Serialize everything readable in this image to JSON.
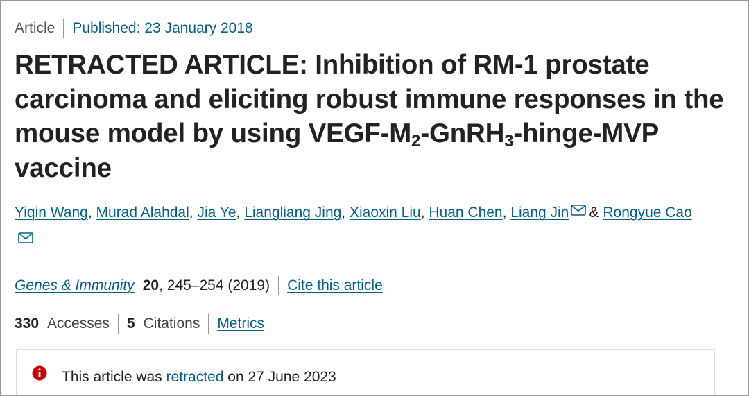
{
  "header": {
    "article_type": "Article",
    "published_label": "Published: 23 January 2018"
  },
  "title": {
    "part1": "RETRACTED ARTICLE: Inhibition of RM-1 prostate carcinoma and eliciting robust immune responses in the mouse model by using VEGF-M",
    "sub1": "2",
    "part2": "-GnRH",
    "sub2": "3",
    "part3": "-hinge-MVP vaccine"
  },
  "authors": [
    {
      "name": "Yiqin Wang",
      "sep": ", "
    },
    {
      "name": "Murad Alahdal",
      "sep": ", "
    },
    {
      "name": "Jia Ye",
      "sep": ", "
    },
    {
      "name": "Liangliang Jing",
      "sep": ", "
    },
    {
      "name": "Xiaoxin Liu",
      "sep": ", "
    },
    {
      "name": "Huan Chen",
      "sep": ", "
    },
    {
      "name": "Liang Jin",
      "sep": ""
    },
    {
      "name": "Rongyue Cao",
      "sep": ""
    }
  ],
  "authors_amp": "&",
  "icons": {
    "email": "email-envelope-icon",
    "notice": "exclamation-circle-icon"
  },
  "journal": {
    "name": "Genes & Immunity",
    "volume": "20",
    "pages_year": ", 245–254 (2019)",
    "cite_label": "Cite this article"
  },
  "metrics": {
    "accesses_count": "330",
    "accesses_label": "Accesses",
    "citations_count": "5",
    "citations_label": "Citations",
    "metrics_link": "Metrics"
  },
  "notice": {
    "prefix": "This article was",
    "link": "retracted",
    "suffix": "on 27 June 2023"
  },
  "colors": {
    "link": "#025e8d",
    "text": "#222222",
    "alert": "#c40606"
  }
}
